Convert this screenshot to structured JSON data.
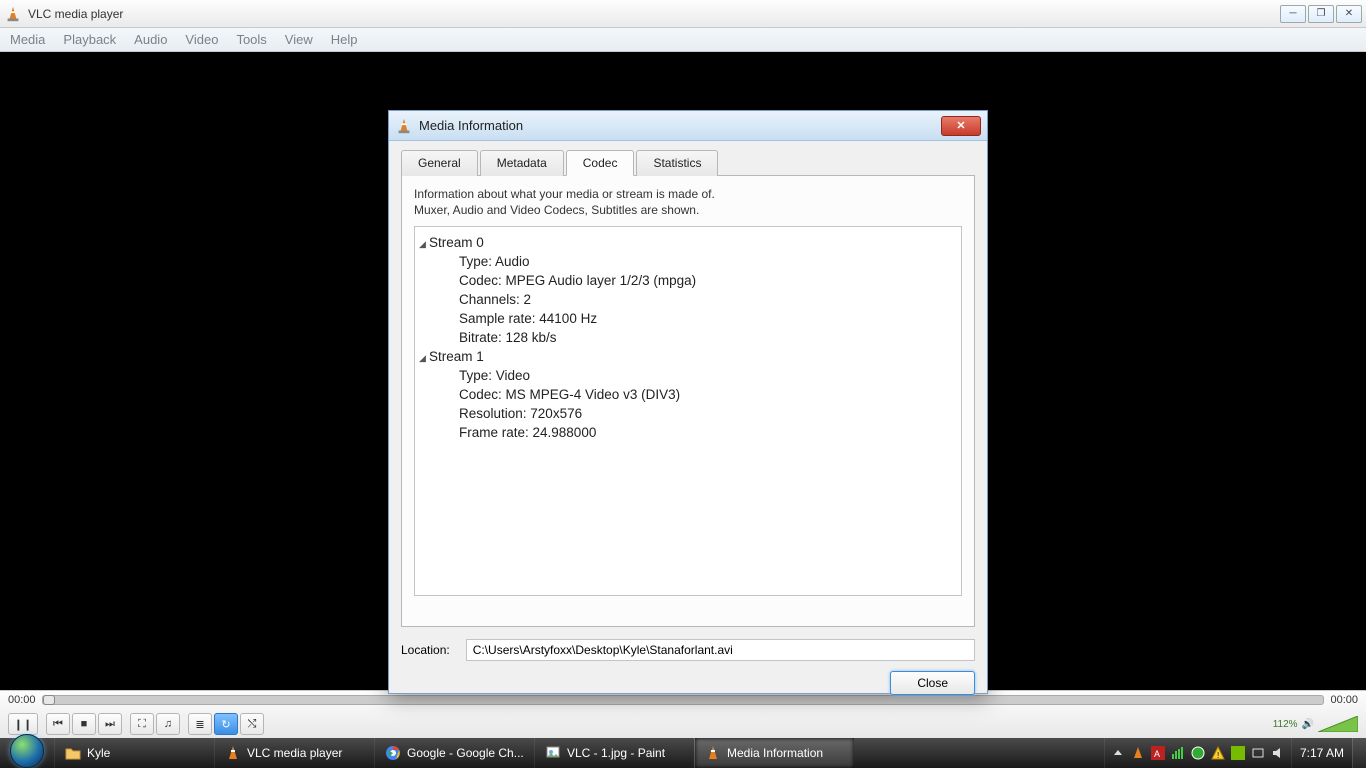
{
  "app": {
    "title": "VLC media player",
    "menus": [
      "Media",
      "Playback",
      "Audio",
      "Video",
      "Tools",
      "View",
      "Help"
    ]
  },
  "transport": {
    "time_left": "00:00",
    "time_right": "00:00",
    "volume_pct": "112%"
  },
  "dialog": {
    "title": "Media Information",
    "tabs": [
      "General",
      "Metadata",
      "Codec",
      "Statistics"
    ],
    "active_tab": 2,
    "hint_line1": "Information about what your media or stream is made of.",
    "hint_line2": "Muxer, Audio and Video Codecs, Subtitles are shown.",
    "streams": [
      {
        "name": "Stream 0",
        "rows": [
          "Type: Audio",
          "Codec: MPEG Audio layer 1/2/3 (mpga)",
          "Channels: 2",
          "Sample rate: 44100 Hz",
          "Bitrate: 128 kb/s"
        ]
      },
      {
        "name": "Stream 1",
        "rows": [
          "Type: Video",
          "Codec: MS MPEG-4 Video v3 (DIV3)",
          "Resolution: 720x576",
          "Frame rate: 24.988000"
        ]
      }
    ],
    "location_label": "Location:",
    "location_value": "C:\\Users\\Arstyfoxx\\Desktop\\Kyle\\Stanaforlant.avi",
    "close_label": "Close"
  },
  "taskbar": {
    "items": [
      {
        "label": "Kyle",
        "icon": "folder"
      },
      {
        "label": "VLC media player",
        "icon": "cone"
      },
      {
        "label": "Google - Google Ch...",
        "icon": "chrome"
      },
      {
        "label": "VLC - 1.jpg - Paint",
        "icon": "paint"
      },
      {
        "label": "Media Information",
        "icon": "cone",
        "active": true
      }
    ],
    "clock": "7:17 AM"
  }
}
